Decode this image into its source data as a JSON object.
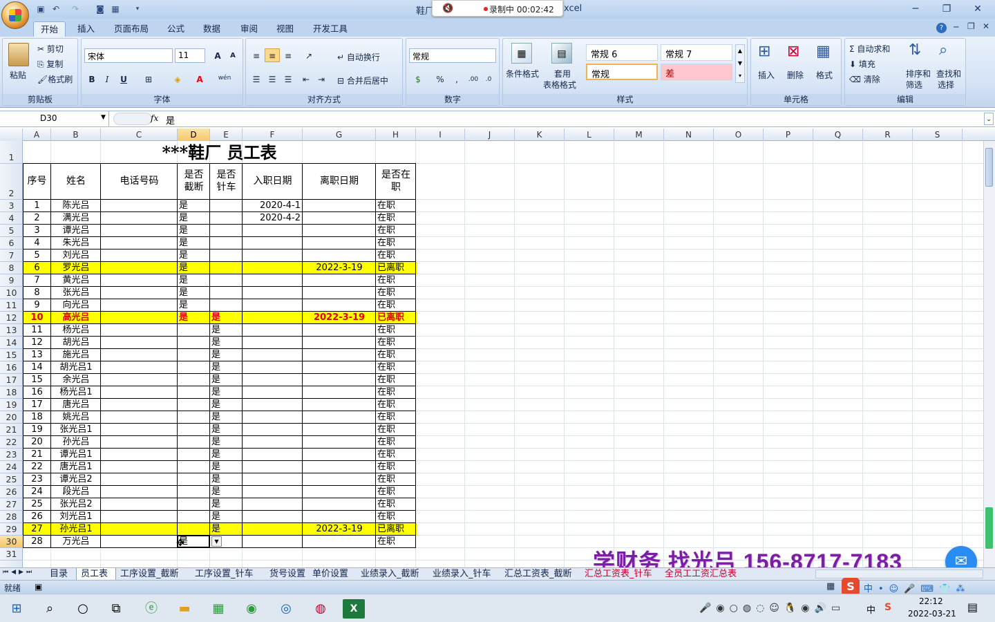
{
  "window": {
    "title_left": "鞋厂",
    "title_right": "xcel",
    "recording": "录制中 00:02:42"
  },
  "tabs": [
    "开始",
    "插入",
    "页面布局",
    "公式",
    "数据",
    "审阅",
    "视图",
    "开发工具"
  ],
  "ribbon": {
    "clipboard": {
      "paste": "粘贴",
      "cut": "剪切",
      "copy": "复制",
      "format_painter": "格式刷",
      "label": "剪贴板"
    },
    "font": {
      "name": "宋体",
      "size": "11",
      "bold": "B",
      "italic": "I",
      "underline": "U",
      "label": "字体",
      "grow": "A",
      "shrink": "A",
      "color_a": "A",
      "wen": "wén"
    },
    "alignment": {
      "wrap": "自动换行",
      "merge": "合并后居中",
      "label": "对齐方式"
    },
    "number": {
      "format": "常规",
      "percent": "%",
      "comma": ",",
      "label": "数字"
    },
    "styles": {
      "cond": "条件格式",
      "table_top": "套用",
      "table_bottom": "表格格式",
      "cells": [
        "常规 6",
        "常规 7",
        "常规",
        "差"
      ],
      "label": "样式"
    },
    "cells": {
      "insert": "插入",
      "delete": "删除",
      "format": "格式",
      "label": "单元格"
    },
    "editing": {
      "autosum": "自动求和",
      "fill": "填充",
      "clear": "清除",
      "sort_top": "排序和",
      "sort_bottom": "筛选",
      "find_top": "查找和",
      "find_bottom": "选择",
      "label": "编辑"
    }
  },
  "formula_bar": {
    "name_box": "D30",
    "fx": "fx",
    "value": "是"
  },
  "columns": [
    "A",
    "B",
    "C",
    "D",
    "E",
    "F",
    "G",
    "H",
    "I",
    "J",
    "K",
    "L",
    "M",
    "N",
    "O",
    "P",
    "Q",
    "R",
    "S"
  ],
  "sheet": {
    "title": "***鞋厂    员工表",
    "headers": {
      "seq": "序号",
      "name": "姓名",
      "phone": "电话号码",
      "cut_1": "是否",
      "cut_2": "截断",
      "sew_1": "是否",
      "sew_2": "针车",
      "hire": "入职日期",
      "leave": "离职日期",
      "status_1": "是否在",
      "status_2": "职"
    },
    "rows": [
      {
        "row": "3",
        "seq": "1",
        "name": "陈光吕",
        "d": "是",
        "e": "",
        "hire": "2020-4-1",
        "leave": "",
        "status": "在职",
        "hl": false,
        "bold": false
      },
      {
        "row": "4",
        "seq": "2",
        "name": "满光吕",
        "d": "是",
        "e": "",
        "hire": "2020-4-2",
        "leave": "",
        "status": "在职",
        "hl": false,
        "bold": false
      },
      {
        "row": "5",
        "seq": "3",
        "name": "谭光吕",
        "d": "是",
        "e": "",
        "hire": "",
        "leave": "",
        "status": "在职",
        "hl": false,
        "bold": false
      },
      {
        "row": "6",
        "seq": "4",
        "name": "朱光吕",
        "d": "是",
        "e": "",
        "hire": "",
        "leave": "",
        "status": "在职",
        "hl": false,
        "bold": false
      },
      {
        "row": "7",
        "seq": "5",
        "name": "刘光吕",
        "d": "是",
        "e": "",
        "hire": "",
        "leave": "",
        "status": "在职",
        "hl": false,
        "bold": false
      },
      {
        "row": "8",
        "seq": "6",
        "name": "罗光吕",
        "d": "是",
        "e": "",
        "hire": "",
        "leave": "2022-3-19",
        "status": "已离职",
        "hl": true,
        "bold": false
      },
      {
        "row": "9",
        "seq": "7",
        "name": "黄光吕",
        "d": "是",
        "e": "",
        "hire": "",
        "leave": "",
        "status": "在职",
        "hl": false,
        "bold": false
      },
      {
        "row": "10",
        "seq": "8",
        "name": "张光吕",
        "d": "是",
        "e": "",
        "hire": "",
        "leave": "",
        "status": "在职",
        "hl": false,
        "bold": false
      },
      {
        "row": "11",
        "seq": "9",
        "name": "向光吕",
        "d": "是",
        "e": "",
        "hire": "",
        "leave": "",
        "status": "在职",
        "hl": false,
        "bold": false
      },
      {
        "row": "12",
        "seq": "10",
        "name": "高光吕",
        "d": "是",
        "e": "是",
        "hire": "",
        "leave": "2022-3-19",
        "status": "已离职",
        "hl": true,
        "bold": true
      },
      {
        "row": "13",
        "seq": "11",
        "name": "杨光吕",
        "d": "",
        "e": "是",
        "hire": "",
        "leave": "",
        "status": "在职",
        "hl": false,
        "bold": false
      },
      {
        "row": "14",
        "seq": "12",
        "name": "胡光吕",
        "d": "",
        "e": "是",
        "hire": "",
        "leave": "",
        "status": "在职",
        "hl": false,
        "bold": false
      },
      {
        "row": "15",
        "seq": "13",
        "name": "施光吕",
        "d": "",
        "e": "是",
        "hire": "",
        "leave": "",
        "status": "在职",
        "hl": false,
        "bold": false
      },
      {
        "row": "16",
        "seq": "14",
        "name": "胡光吕1",
        "d": "",
        "e": "是",
        "hire": "",
        "leave": "",
        "status": "在职",
        "hl": false,
        "bold": false
      },
      {
        "row": "17",
        "seq": "15",
        "name": "余光吕",
        "d": "",
        "e": "是",
        "hire": "",
        "leave": "",
        "status": "在职",
        "hl": false,
        "bold": false
      },
      {
        "row": "18",
        "seq": "16",
        "name": "杨光吕1",
        "d": "",
        "e": "是",
        "hire": "",
        "leave": "",
        "status": "在职",
        "hl": false,
        "bold": false
      },
      {
        "row": "19",
        "seq": "17",
        "name": "唐光吕",
        "d": "",
        "e": "是",
        "hire": "",
        "leave": "",
        "status": "在职",
        "hl": false,
        "bold": false
      },
      {
        "row": "20",
        "seq": "18",
        "name": "姚光吕",
        "d": "",
        "e": "是",
        "hire": "",
        "leave": "",
        "status": "在职",
        "hl": false,
        "bold": false
      },
      {
        "row": "21",
        "seq": "19",
        "name": "张光吕1",
        "d": "",
        "e": "是",
        "hire": "",
        "leave": "",
        "status": "在职",
        "hl": false,
        "bold": false
      },
      {
        "row": "22",
        "seq": "20",
        "name": "孙光吕",
        "d": "",
        "e": "是",
        "hire": "",
        "leave": "",
        "status": "在职",
        "hl": false,
        "bold": false
      },
      {
        "row": "23",
        "seq": "21",
        "name": "谭光吕1",
        "d": "",
        "e": "是",
        "hire": "",
        "leave": "",
        "status": "在职",
        "hl": false,
        "bold": false
      },
      {
        "row": "24",
        "seq": "22",
        "name": "唐光吕1",
        "d": "",
        "e": "是",
        "hire": "",
        "leave": "",
        "status": "在职",
        "hl": false,
        "bold": false
      },
      {
        "row": "25",
        "seq": "23",
        "name": "谭光吕2",
        "d": "",
        "e": "是",
        "hire": "",
        "leave": "",
        "status": "在职",
        "hl": false,
        "bold": false
      },
      {
        "row": "26",
        "seq": "24",
        "name": "段光吕",
        "d": "",
        "e": "是",
        "hire": "",
        "leave": "",
        "status": "在职",
        "hl": false,
        "bold": false
      },
      {
        "row": "27",
        "seq": "25",
        "name": "张光吕2",
        "d": "",
        "e": "是",
        "hire": "",
        "leave": "",
        "status": "在职",
        "hl": false,
        "bold": false
      },
      {
        "row": "28",
        "seq": "26",
        "name": "刘光吕1",
        "d": "",
        "e": "是",
        "hire": "",
        "leave": "",
        "status": "在职",
        "hl": false,
        "bold": false
      },
      {
        "row": "29",
        "seq": "27",
        "name": "孙光吕1",
        "d": "",
        "e": "是",
        "hire": "",
        "leave": "2022-3-19",
        "status": "已离职",
        "hl": true,
        "bold": false
      },
      {
        "row": "30",
        "seq": "28",
        "name": "万光吕",
        "d": "是",
        "e": "",
        "hire": "",
        "leave": "",
        "status": "在职",
        "hl": false,
        "bold": false
      }
    ],
    "row_1": "1",
    "row_2": "2",
    "row_31": "31"
  },
  "sheet_tabs": [
    "目录",
    "员工表",
    "工序设置_截断",
    "工序设置_针车",
    "货号设置",
    "单价设置",
    "业绩录入_截断",
    "业绩录入_针车",
    "汇总工资表_截断",
    "汇总工资表_针车",
    "全员工工资汇总表"
  ],
  "status": {
    "ready": "就绪"
  },
  "promo": "学财务  找光吕   156-8717-7183",
  "taskbar": {
    "time": "22:12",
    "date": "2022-03-21",
    "ime": "中"
  },
  "colors": {
    "highlight": "#ffff00",
    "bold_red": "#e00000",
    "promo": "#7b1fa2",
    "ribbon": "#dce8f7"
  }
}
